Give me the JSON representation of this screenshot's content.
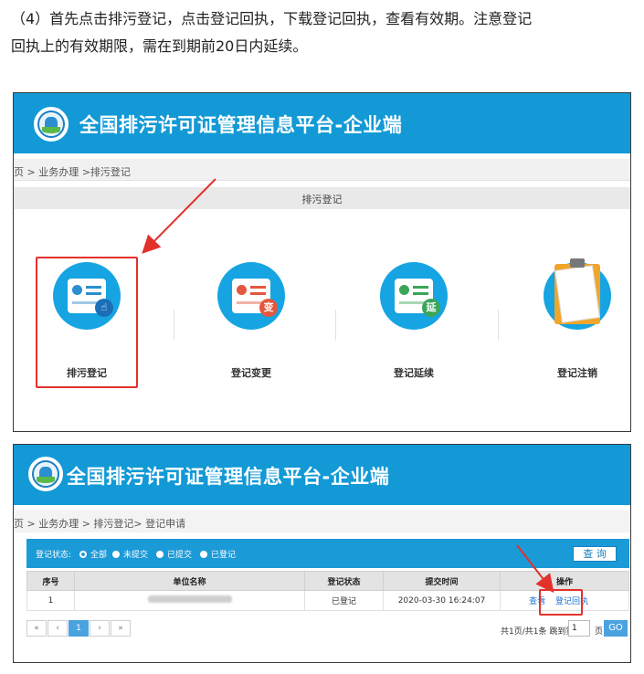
{
  "intro": {
    "line1": "（4）首先点击排污登记，点击登记回执，下载登记回执，查看有效期。注意登记",
    "line2": "回执上的有效期限，需在到期前20日内延续。"
  },
  "shot1": {
    "platform_title": "全国排污许可证管理信息平台-企业端",
    "breadcrumb": "首页 > 业务办理 >排污登记",
    "section_title": "排污登记",
    "tiles": [
      {
        "label": "排污登记"
      },
      {
        "label": "登记变更",
        "badge": "变"
      },
      {
        "label": "登记延续",
        "badge": "延"
      },
      {
        "label": "登记注销"
      }
    ]
  },
  "shot2": {
    "platform_title": "全国排污许可证管理信息平台-企业端",
    "breadcrumb": "首页 > 业务办理 > 排污登记> 登记申请",
    "filter": {
      "label": "登记状态:",
      "options": [
        "全部",
        "未提交",
        "已提交",
        "已登记"
      ],
      "selected": "全部",
      "query_button": "查 询"
    },
    "table": {
      "headers": [
        "序号",
        "单位名称",
        "登记状态",
        "提交时间",
        "操作"
      ],
      "rows": [
        {
          "index": "1",
          "status": "已登记",
          "submit_time": "2020-03-30 16:24:07",
          "view_link": "查看",
          "receipt_link": "登记回执"
        }
      ]
    },
    "pager": {
      "first": "«",
      "prev": "‹",
      "current": "1",
      "next": "›",
      "last": "»",
      "info": "共1页/共1条 跳到第",
      "input_value": "1",
      "page_unit": "页",
      "go_button": "GO"
    }
  },
  "colors": {
    "banner": "#1299d6",
    "highlight": "#e3312c",
    "link": "#1b6fd0"
  }
}
